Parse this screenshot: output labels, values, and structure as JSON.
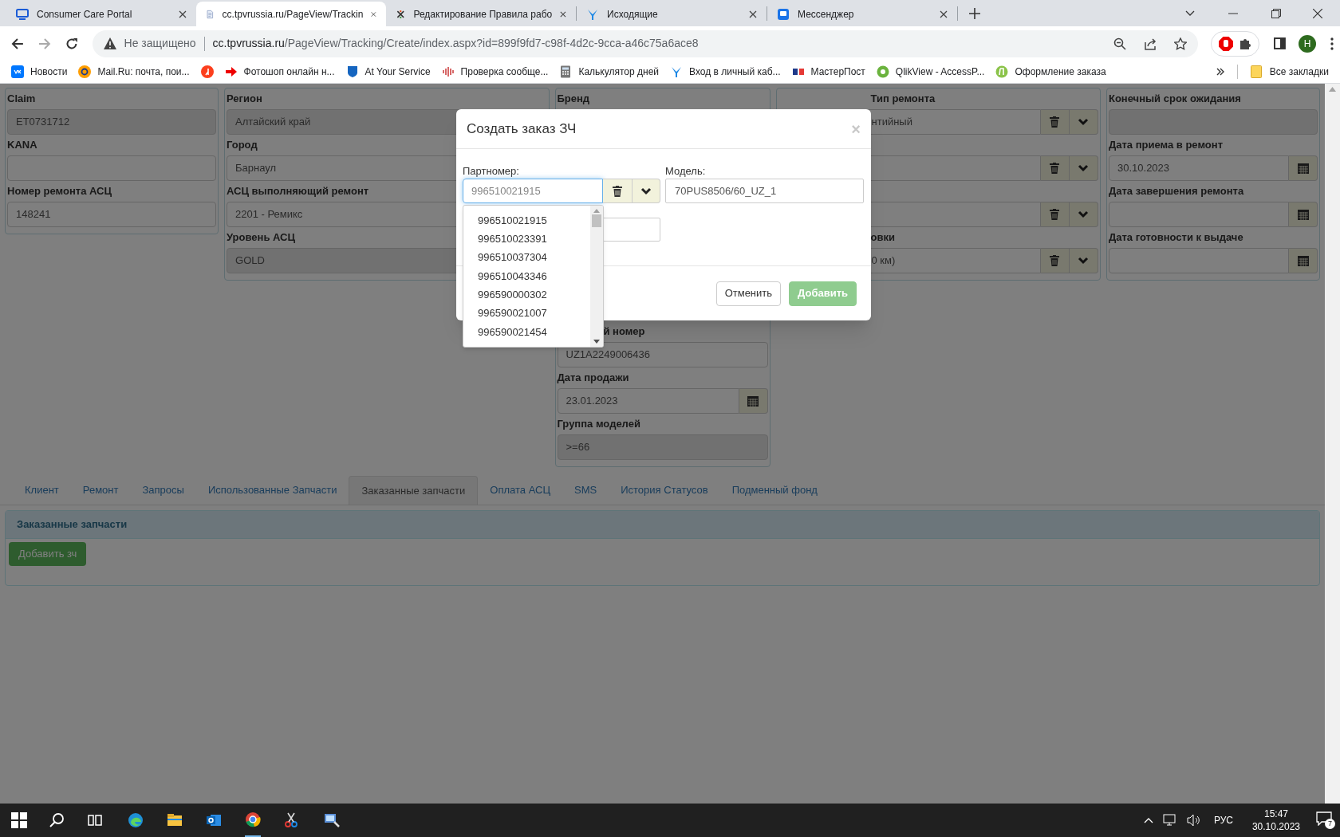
{
  "browser": {
    "tabs": [
      {
        "title": "Consumer Care Portal",
        "selected": false
      },
      {
        "title": "cc.tpvrussia.ru/PageView/Trackin",
        "selected": true
      },
      {
        "title": "Редактирование Правила рабо",
        "selected": false
      },
      {
        "title": "Исходящие",
        "selected": false
      },
      {
        "title": "Мессенджер",
        "selected": false
      }
    ],
    "address": {
      "security": "Не защищено",
      "host": "cc.tpvrussia.ru",
      "path": "/PageView/Tracking/Create/index.aspx?id=899f9fd7-c98f-4d2c-9cca-a46c75a6ace8"
    },
    "profile": "H",
    "bookmarks": [
      {
        "kind": "link",
        "label": "Новости"
      },
      {
        "kind": "link",
        "label": "Mail.Ru: почта, пои..."
      },
      {
        "kind": "icon"
      },
      {
        "kind": "link",
        "label": "Фотошоп онлайн н..."
      },
      {
        "kind": "link",
        "label": "At Your Service"
      },
      {
        "kind": "link",
        "label": "Проверка сообще..."
      },
      {
        "kind": "link",
        "label": "Калькулятор дней"
      },
      {
        "kind": "link",
        "label": "Вход в личный каб..."
      },
      {
        "kind": "link",
        "label": "МастерПост"
      },
      {
        "kind": "link",
        "label": "QlikView - AccessP..."
      },
      {
        "kind": "link",
        "label": "Оформление заказа"
      }
    ],
    "all_bookmarks": "Все закладки"
  },
  "page": {
    "columns": [
      {
        "clipped": false,
        "fields": [
          {
            "label": "Claim",
            "value": "ET0731712",
            "kind": "text",
            "disabled": true
          },
          {
            "label": "KANA",
            "kind": "text",
            "disabled": false
          },
          {
            "label": "Номер ремонта АСЦ",
            "value": "148241",
            "kind": "text",
            "disabled": false
          }
        ]
      },
      {
        "clipped": false,
        "fields": [
          {
            "label": "Регион",
            "value": "Алтайский край",
            "kind": "text",
            "disabled": true
          },
          {
            "label": "Город",
            "value": "Барнаул",
            "kind": "text",
            "disabled": false
          },
          {
            "label": "АСЦ выполняющий ремонт",
            "value": "2201 - Ремикс",
            "kind": "text",
            "disabled": false
          },
          {
            "label": "Уровень АСЦ",
            "value": "GOLD",
            "kind": "text",
            "disabled": true
          }
        ]
      },
      {
        "clipped": false,
        "fields": [
          {
            "label": "Бренд",
            "kind": "covered"
          },
          {
            "label": "й номер",
            "value": "UZ1A2249006436",
            "kind": "text",
            "disabled": false,
            "label_clipped": true
          },
          {
            "label": "Дата продажи",
            "value": "23.01.2023",
            "kind": "date",
            "disabled": false
          },
          {
            "label": "Группа моделей",
            "value": ">=66",
            "kind": "text",
            "disabled": true
          }
        ]
      },
      {
        "clipped": true,
        "fields": [
          {
            "label": "Тип ремонта",
            "value": "нтийный",
            "kind": "select",
            "disabled": false
          },
          {
            "kind": "select",
            "disabled": false
          },
          {
            "kind": "select",
            "disabled": false
          },
          {
            "label": "овки",
            "value": "0 км)",
            "kind": "select",
            "disabled": false
          }
        ]
      },
      {
        "clipped": false,
        "fields": [
          {
            "label": "Конечный срок ожидания",
            "kind": "text",
            "disabled": true
          },
          {
            "label": "Дата приема в ремонт",
            "value": "30.10.2023",
            "kind": "date",
            "disabled": false
          },
          {
            "label": "Дата завершения ремонта",
            "kind": "date",
            "disabled": false
          },
          {
            "label": "Дата готовности к выдаче",
            "kind": "date",
            "disabled": false
          }
        ]
      }
    ],
    "tabs": [
      {
        "label": "Клиент",
        "selected": false
      },
      {
        "label": "Ремонт",
        "selected": false
      },
      {
        "label": "Запросы",
        "selected": false
      },
      {
        "label": "Использованные Запчасти",
        "selected": false
      },
      {
        "label": "Заказанные запчасти",
        "selected": true
      },
      {
        "label": "Оплата АСЦ",
        "selected": false
      },
      {
        "label": "SMS",
        "selected": false
      },
      {
        "label": "История Статусов",
        "selected": false
      },
      {
        "label": "Подменный фонд",
        "selected": false
      }
    ],
    "panel": {
      "title": "Заказанные запчасти",
      "button": "Добавить зч"
    }
  },
  "dialog": {
    "title": "Создать заказ ЗЧ",
    "close": "×",
    "part_label": "Партномер:",
    "part_placeholder": "996510021915",
    "model_label": "Модель:",
    "model_value": "70PUS8506/60_UZ_1",
    "options": [
      "996510021915",
      "996510023391",
      "996510037304",
      "996510043346",
      "996590000302",
      "996590021007",
      "996590021454"
    ],
    "buttons": [
      {
        "label": "Отменить",
        "kind": "default"
      },
      {
        "label": "Добавить",
        "kind": "primary"
      }
    ]
  },
  "taskbar": {
    "language": "РУС",
    "time": "15:47",
    "date": "30.10.2023",
    "notifications": "7"
  }
}
